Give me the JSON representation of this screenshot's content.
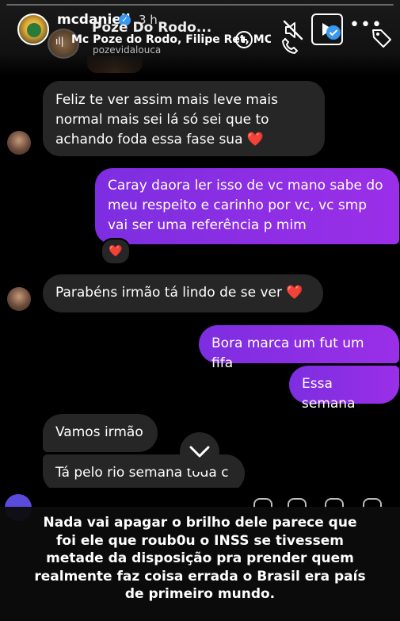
{
  "header": {
    "username": "mcdaniell",
    "time": "3 h",
    "verified_icon": "verified-badge-icon",
    "progress": 0.0
  },
  "music": {
    "title": "Poze Do Rodo...",
    "artists": "Mc Poze do Rodo, Filipe Ret, MC Ryan",
    "handle": "pozevidalouca"
  },
  "controls": {
    "mute_icon": "muted-speaker-icon",
    "play_icon": "play-icon",
    "more_label": "•••",
    "tag_icon": "tag-icon"
  },
  "messages": [
    {
      "from": "them",
      "text": "Feliz te ver assim mais leve mais normal mais sei lá só sei que to achando foda essa fase sua",
      "emoji": "❤️"
    },
    {
      "from": "me",
      "text": "Caray daora ler isso de vc mano sabe do meu respeito e carinho por vc, vc smp vai ser uma referência p mim",
      "reaction": "❤️"
    },
    {
      "from": "them",
      "text": "Parabéns irmão tá lindo de se ver",
      "emoji": "❤️"
    },
    {
      "from": "me",
      "text": "Bora marca um fut um fifa"
    },
    {
      "from": "me",
      "text": "Essa semana"
    },
    {
      "from": "them",
      "text": "Vamos irmão"
    },
    {
      "from": "them",
      "text": "Tá pelo rio semana toda c"
    }
  ],
  "caption": "Nada vai apagar o brilho dele\nparece que foi ele que roub0u o INSS se tivessem metade da disposição pra prender quem realmente faz coisa errada o Brasil era país de primeiro mundo.",
  "colors": {
    "sent_bubble": "#8a2be2",
    "received_bubble": "#262626",
    "heart": "#ff3040",
    "verified": "#3897f0"
  }
}
